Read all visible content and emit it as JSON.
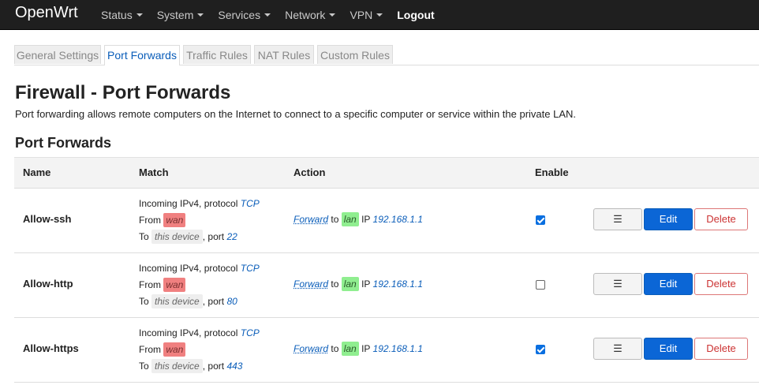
{
  "header": {
    "brand": "OpenWrt",
    "menu": [
      "Status",
      "System",
      "Services",
      "Network",
      "VPN"
    ],
    "logout": "Logout"
  },
  "tabs": [
    "General Settings",
    "Port Forwards",
    "Traffic Rules",
    "NAT Rules",
    "Custom Rules"
  ],
  "active_tab": "Port Forwards",
  "page": {
    "title": "Firewall - Port Forwards",
    "description": "Port forwarding allows remote computers on the Internet to connect to a specific computer or service within the private LAN.",
    "section_title": "Port Forwards"
  },
  "table": {
    "columns": [
      "Name",
      "Match",
      "Action",
      "Enable"
    ],
    "rows": [
      {
        "name": "Allow-ssh",
        "match_prefix": "Incoming IPv4, protocol",
        "protocol": "TCP",
        "from_label": "From",
        "from_zone": "wan",
        "to_label": "To",
        "to_target": "this device",
        "port_label": ", port",
        "port": "22",
        "action_verb": "Forward",
        "action_to": "to",
        "action_zone": "lan",
        "action_ip_label": "IP",
        "action_ip": "192.168.1.1",
        "enabled": true,
        "menu_btn": "☰",
        "edit_btn": "Edit",
        "delete_btn": "Delete"
      },
      {
        "name": "Allow-http",
        "match_prefix": "Incoming IPv4, protocol",
        "protocol": "TCP",
        "from_label": "From",
        "from_zone": "wan",
        "to_label": "To",
        "to_target": "this device",
        "port_label": ", port",
        "port": "80",
        "action_verb": "Forward",
        "action_to": "to",
        "action_zone": "lan",
        "action_ip_label": "IP",
        "action_ip": "192.168.1.1",
        "enabled": false,
        "menu_btn": "☰",
        "edit_btn": "Edit",
        "delete_btn": "Delete"
      },
      {
        "name": "Allow-https",
        "match_prefix": "Incoming IPv4, protocol",
        "protocol": "TCP",
        "from_label": "From",
        "from_zone": "wan",
        "to_label": "To",
        "to_target": "this device",
        "port_label": ", port",
        "port": "443",
        "action_verb": "Forward",
        "action_to": "to",
        "action_zone": "lan",
        "action_ip_label": "IP",
        "action_ip": "192.168.1.1",
        "enabled": true,
        "menu_btn": "☰",
        "edit_btn": "Edit",
        "delete_btn": "Delete"
      }
    ]
  },
  "colors": {
    "topbar": "#1f1f1f",
    "accent": "#0b66d6",
    "zone_wan": "#f08080",
    "zone_lan": "#90ee90",
    "delete": "#cc3333"
  }
}
